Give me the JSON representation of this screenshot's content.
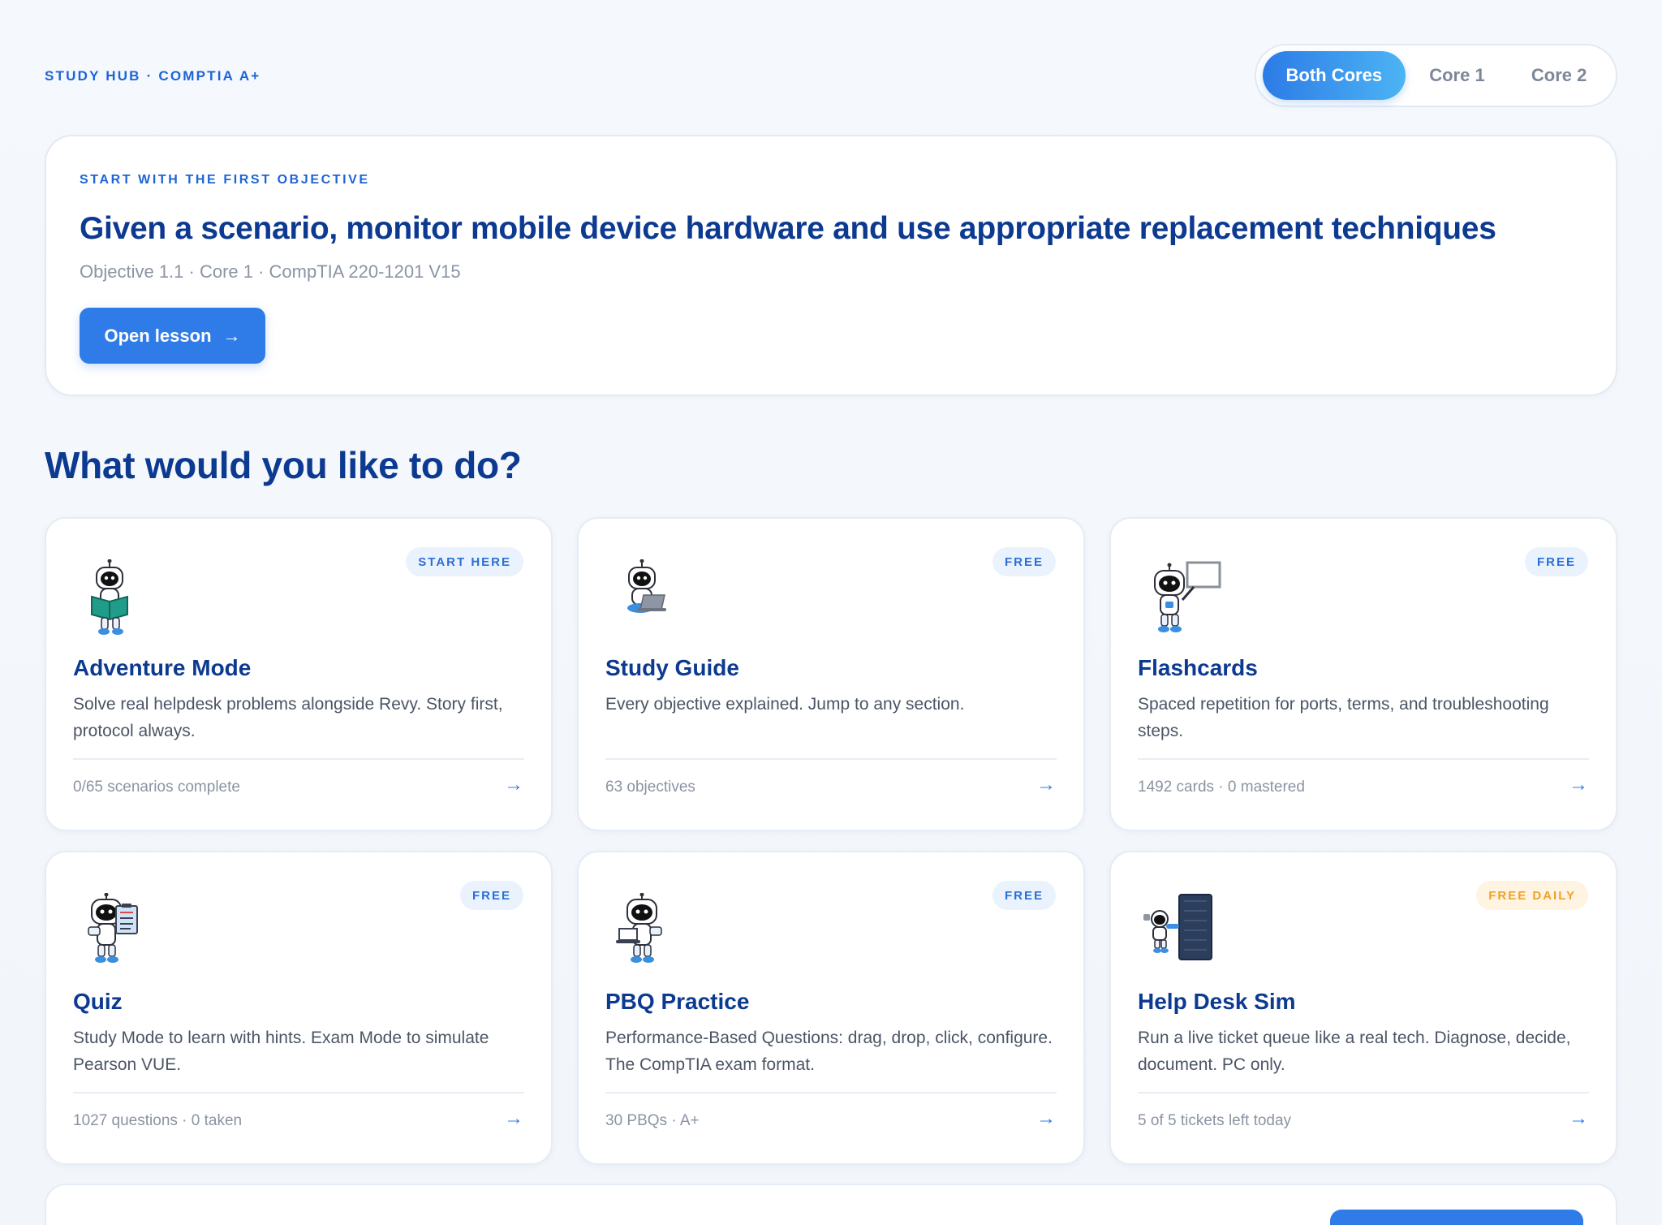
{
  "header": {
    "brand": "STUDY HUB · COMPTIA A+",
    "scope_tabs": [
      "Both Cores",
      "Core 1",
      "Core 2"
    ],
    "active_tab": "Both Cores"
  },
  "hero": {
    "eyebrow": "START WITH THE FIRST OBJECTIVE",
    "title": "Given a scenario, monitor mobile device hardware and use appropriate replacement techniques",
    "meta": "Objective 1.1 · Core 1 · CompTIA 220-1201 V15",
    "button_label": "Open lesson",
    "button_icon": "arrow-right-icon"
  },
  "section_title": "What would you like to do?",
  "cards": [
    {
      "badge": "START HERE",
      "title": "Adventure Mode",
      "description": "Solve real helpdesk problems alongside Revy. Story first, protocol always.",
      "footer": "0/65 scenarios complete",
      "icon": "robot-reading-icon"
    },
    {
      "badge": "FREE",
      "title": "Study Guide",
      "description": "Every objective explained. Jump to any section.",
      "footer": "63 objectives",
      "icon": "robot-laptop-icon"
    },
    {
      "badge": "FREE",
      "title": "Flashcards",
      "description": "Spaced repetition for ports, terms, and troubleshooting steps.",
      "footer": "1492 cards · 0 mastered",
      "icon": "robot-board-icon"
    },
    {
      "badge": "FREE",
      "title": "Quiz",
      "description": "Study Mode to learn with hints. Exam Mode to simulate Pearson VUE.",
      "footer": "1027 questions · 0 taken",
      "icon": "robot-clipboard-icon"
    },
    {
      "badge": "FREE",
      "title": "PBQ Practice",
      "description": "Performance-Based Questions: drag, drop, click, configure. The CompTIA exam format.",
      "footer": "30 PBQs · A+",
      "icon": "robot-laptop-icon"
    },
    {
      "badge": "FREE DAILY",
      "title": "Help Desk Sim",
      "description": "Run a live ticket queue like a real tech. Diagnose, decide, document. PC only.",
      "footer": "5 of 5 tickets left today",
      "icon": "robot-server-icon"
    }
  ],
  "colors": {
    "accent": "#2f7ce8",
    "heading": "#0d3a91",
    "badge_daily": "#f0a12a"
  }
}
